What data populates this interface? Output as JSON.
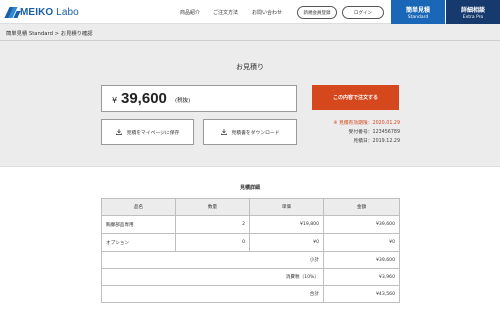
{
  "header": {
    "logo_brand": "MEIKO",
    "logo_suffix": " Labo",
    "nav": [
      "商品紹介",
      "ご注文方法",
      "お問い合わせ"
    ],
    "register_label": "新規会員登録",
    "login_label": "ログイン",
    "standard": {
      "title": "簡単見積",
      "sub": "Standard"
    },
    "pro": {
      "title": "詳細相談",
      "sub": "Extra Pro"
    }
  },
  "breadcrumb": "簡単見積 Standard > お見積り確認",
  "quote": {
    "title": "お見積り",
    "currency": "¥",
    "amount": "39,600",
    "tax_note": "(税抜)",
    "order_button": "この内容で注文する",
    "save_button": "見積をマイページに保存",
    "download_button": "見積書をダウンロード",
    "valid_until": "※ 見積有効期限：2020.01.29",
    "reception_no": "受付番号：123456789",
    "issue_date": "見積日：2019.12.29"
  },
  "details": {
    "title": "見積詳細",
    "headers": [
      "品名",
      "数量",
      "単価",
      "金額"
    ],
    "rows": [
      {
        "name": "胸腺部品専用",
        "qty": "2",
        "unit": "¥19,800",
        "amount": "¥39,600"
      },
      {
        "name": "オプション",
        "qty": "0",
        "unit": "¥0",
        "amount": "¥0"
      }
    ],
    "subtotal_label": "小計",
    "subtotal_value": "¥39,600",
    "tax_label": "消費税（10%）",
    "tax_value": "¥3,960",
    "total_label": "合計",
    "total_value": "¥43,560"
  },
  "colors": {
    "brand_blue": "#1a5fa8",
    "standard_blue": "#1967b6",
    "pro_navy": "#173a6e",
    "order_orange": "#d5481d"
  },
  "icons": {
    "save": "download-tray-icon",
    "download": "download-tray-icon"
  }
}
